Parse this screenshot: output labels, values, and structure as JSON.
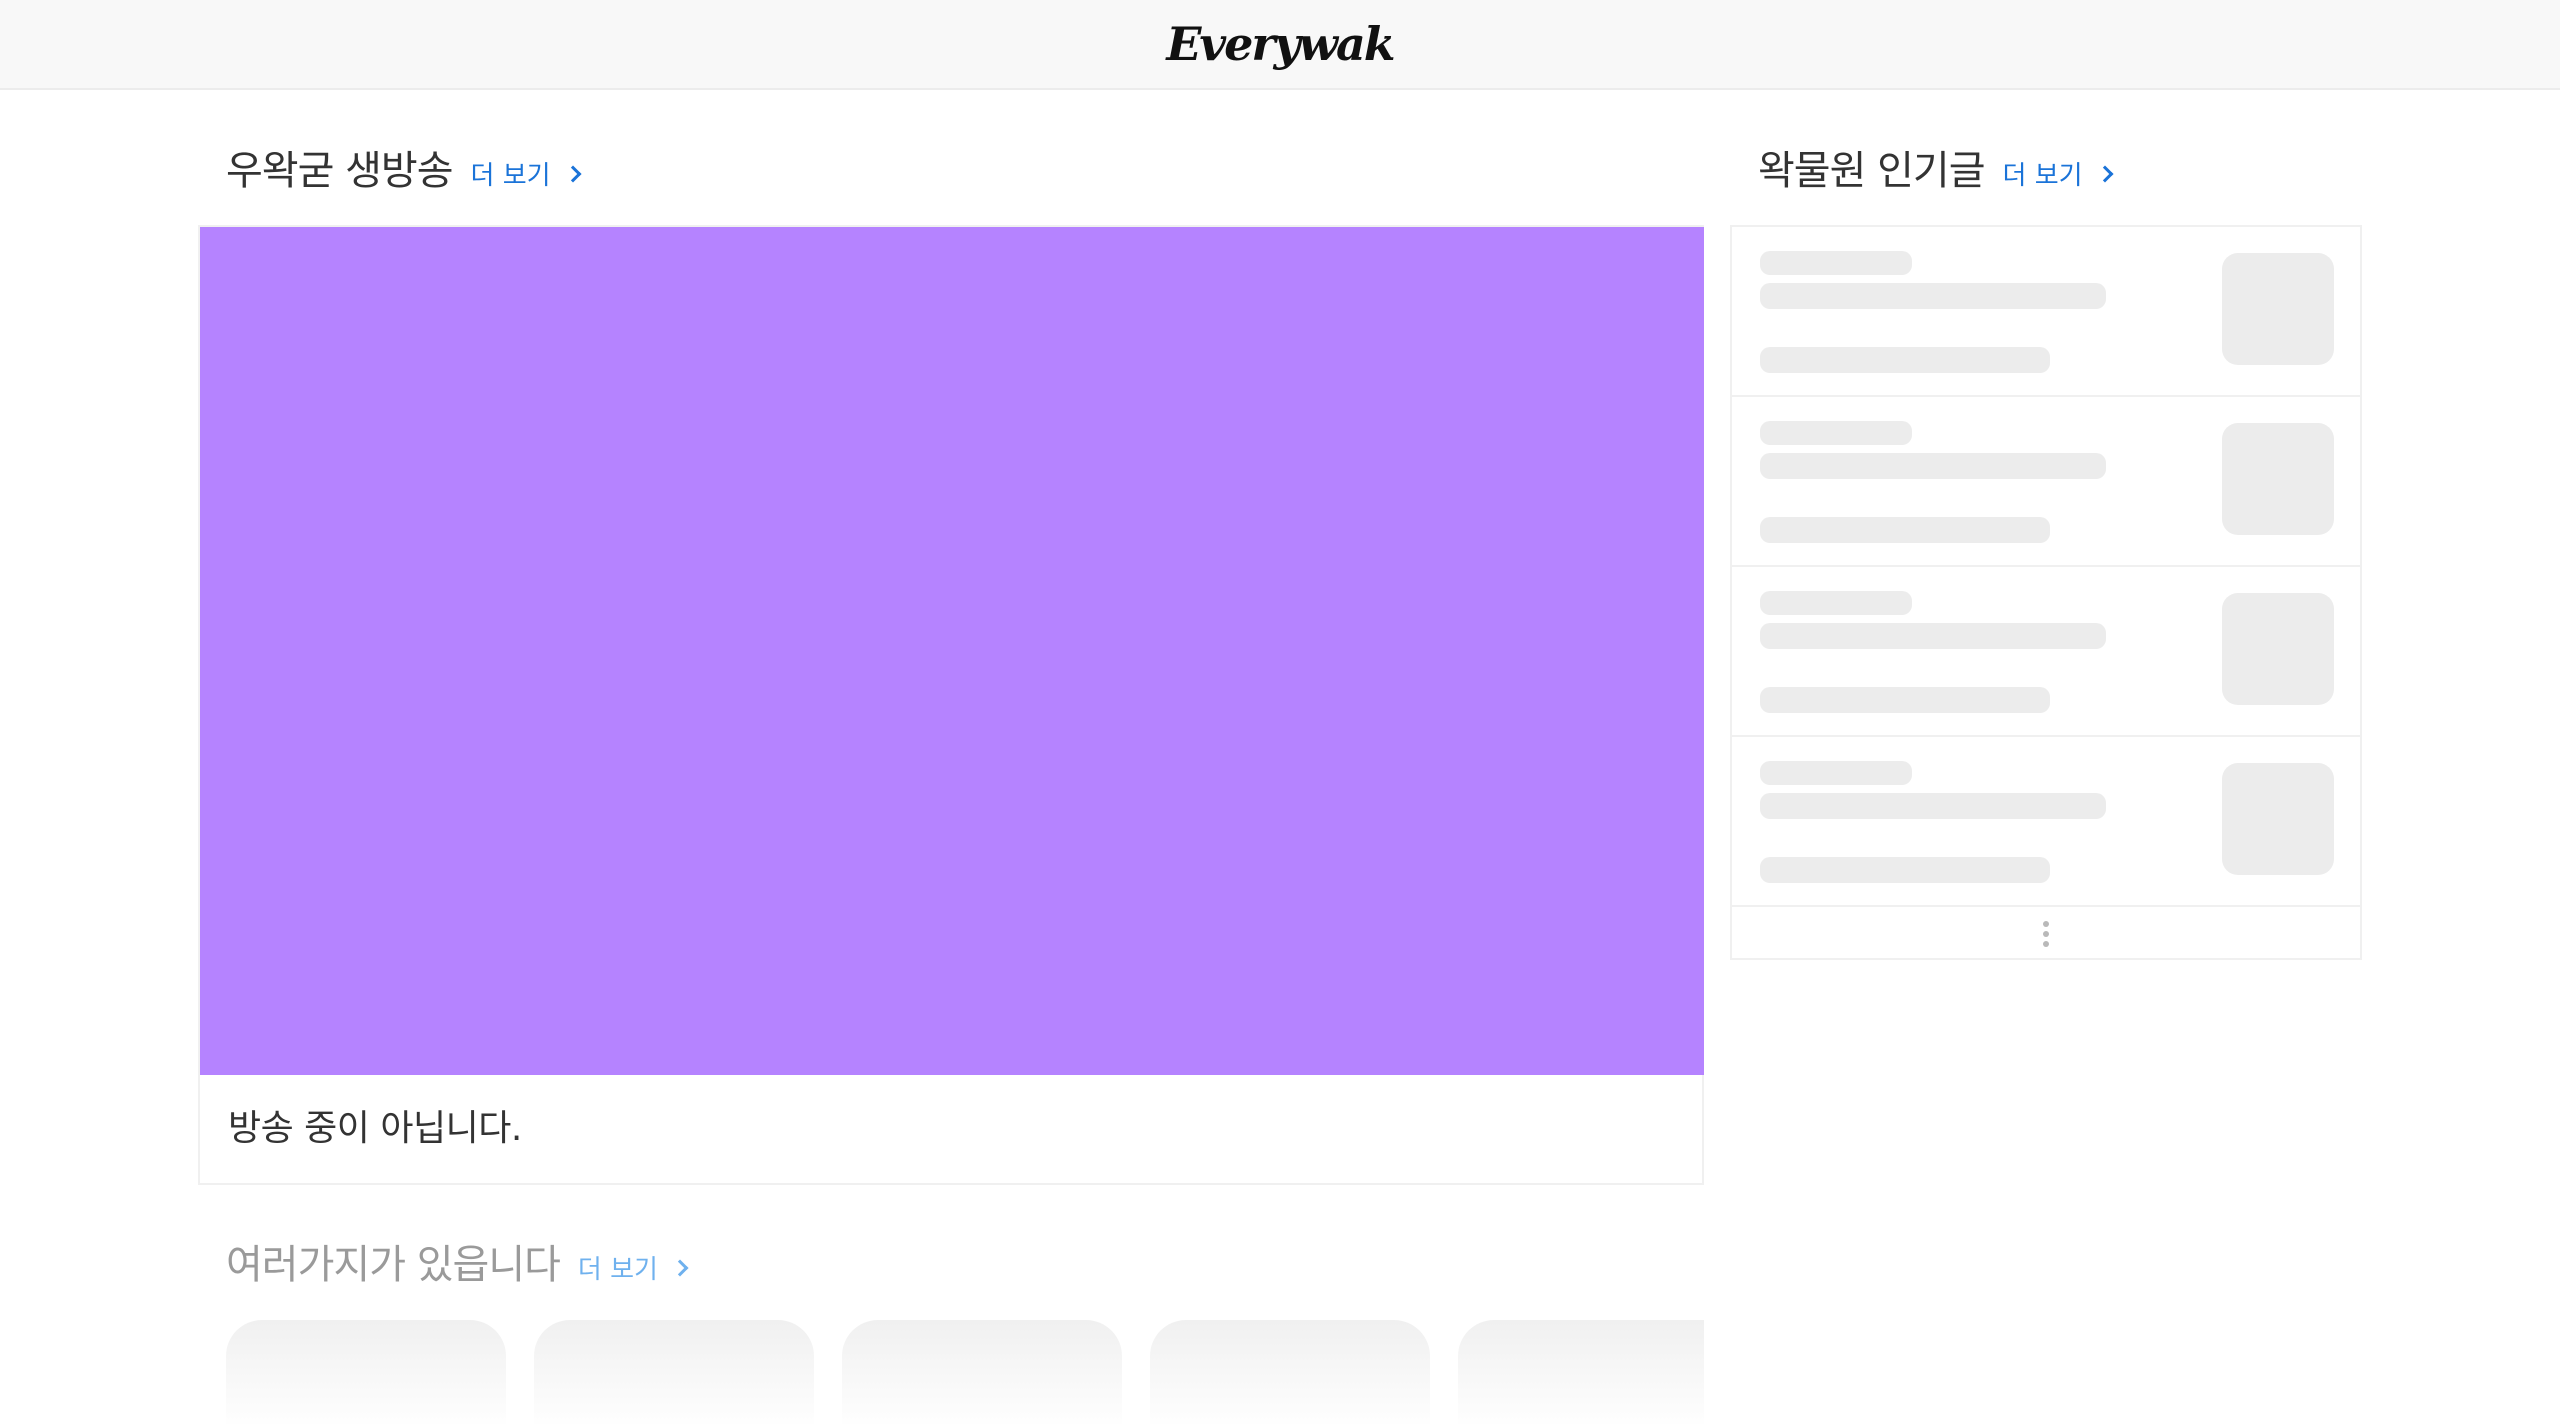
{
  "header": {
    "logo_text": "Everywak"
  },
  "live": {
    "title": "우왁굳 생방송",
    "more_label": "더 보기",
    "status_text": "방송 중이 아닙니다.",
    "player_color": "#b583ff"
  },
  "popular": {
    "title": "왁물원 인기글",
    "more_label": "더 보기",
    "skeleton_rows": 4,
    "more_icon": "more-vertical-icon"
  },
  "misc": {
    "title": "여러가지가 있읍니다",
    "more_label": "더 보기",
    "cards": 5
  },
  "colors": {
    "accent_link": "#1a73d8",
    "skeleton": "#ececec",
    "header_bg": "#f8f8f8"
  }
}
